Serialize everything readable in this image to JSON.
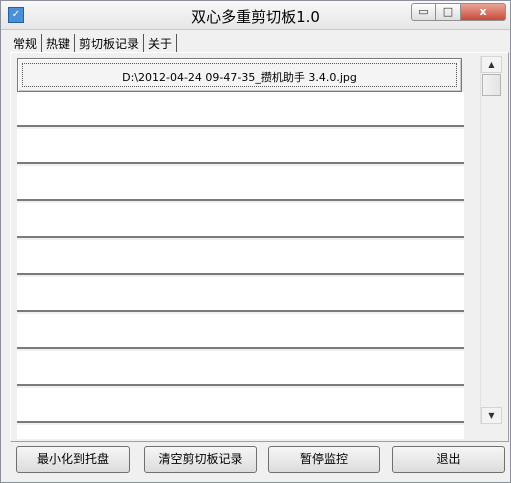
{
  "window": {
    "title": "双心多重剪切板1.0",
    "icon": "clipboard-app-icon",
    "controls": {
      "minimize": "▭",
      "maximize": "□",
      "close": "x"
    }
  },
  "tabs": [
    {
      "label": "常规"
    },
    {
      "label": "热键"
    },
    {
      "label": "剪切板记录",
      "active": true
    },
    {
      "label": "关于"
    }
  ],
  "records": [
    {
      "text": "D:\\2012-04-24 09-47-35_攒机助手 3.4.0.jpg",
      "selected": true
    }
  ],
  "buttons": {
    "minimize_to_tray": "最小化到托盘",
    "clear_records": "清空剪切板记录",
    "pause_monitor": "暂停监控",
    "exit": "退出"
  },
  "scrollbar": {
    "up": "▲",
    "down": "▼"
  }
}
